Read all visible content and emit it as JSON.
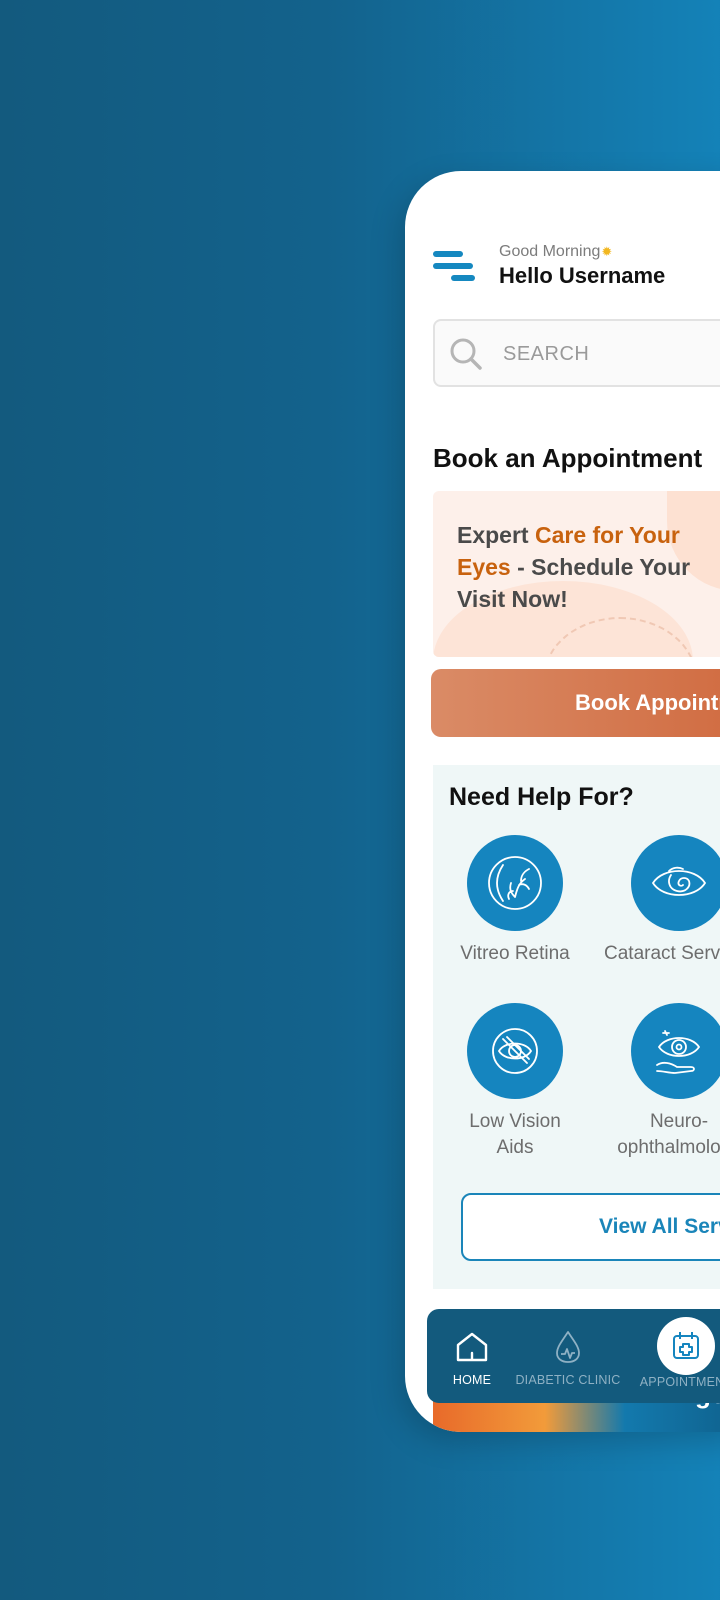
{
  "header": {
    "greeting_small": "Good Morning",
    "greeting_name": "Hello Username"
  },
  "search": {
    "placeholder": "SEARCH"
  },
  "appointment": {
    "section_title": "Book an Appointment",
    "promo_part1": "Expert ",
    "promo_highlight": "Care for Your Eyes",
    "promo_part2": " - Schedule Your Visit Now!",
    "book_button": "Book Appointment"
  },
  "help": {
    "title": "Need Help For?",
    "services": [
      {
        "label": "Vitreo Retina",
        "icon": "retina-icon"
      },
      {
        "label": "Cataract Services",
        "icon": "cataract-eye-icon"
      },
      {
        "label": "Low Vision\nAids",
        "icon": "low-vision-eye-icon"
      },
      {
        "label": "Neuro-\nophthalmology",
        "icon": "neuro-eye-icon"
      }
    ],
    "view_all": "View All Services"
  },
  "banner": {
    "text": "get"
  },
  "bottom_nav": {
    "items": [
      {
        "label": "HOME",
        "icon": "home-icon",
        "active": true
      },
      {
        "label": "DIABETIC CLINIC",
        "icon": "diabetic-drop-icon",
        "active": false
      },
      {
        "label": "APPOINTMENT",
        "icon": "calendar-plus-icon",
        "active": false
      }
    ]
  },
  "colors": {
    "primary_blue": "#1585bf",
    "accent_orange": "#c8620e",
    "nav_bg": "#135a7d"
  }
}
